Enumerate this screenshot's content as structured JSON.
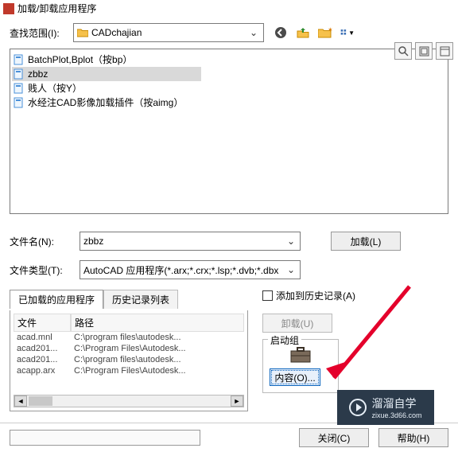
{
  "window": {
    "title": "加载/卸载应用程序"
  },
  "lookin": {
    "label": "查找范围(I):",
    "value": "CADchajian"
  },
  "files": [
    {
      "name": "BatchPlot,Bplot（按bp）",
      "selected": false
    },
    {
      "name": "zbbz",
      "selected": true
    },
    {
      "name": "贱人（按Y）",
      "selected": false
    },
    {
      "name": "水经注CAD影像加载插件（按aimg）",
      "selected": false
    }
  ],
  "filename": {
    "label": "文件名(N):",
    "value": "zbbz"
  },
  "filetype": {
    "label": "文件类型(T):",
    "value": "AutoCAD 应用程序(*.arx;*.crx;*.lsp;*.dvb;*.dbx"
  },
  "buttons": {
    "load": "加载(L)",
    "unload": "卸载(U)",
    "contents": "内容(O)...",
    "close": "关闭(C)",
    "help": "帮助(H)"
  },
  "tabs": {
    "loaded": "已加载的应用程序",
    "history": "历史记录列表"
  },
  "grid": {
    "col_file": "文件",
    "col_path": "路径",
    "rows": [
      {
        "file": "acad.mnl",
        "path": "C:\\program files\\autodesk..."
      },
      {
        "file": "acad201...",
        "path": "C:\\Program Files\\Autodesk..."
      },
      {
        "file": "acad201...",
        "path": "C:\\program files\\autodesk..."
      },
      {
        "file": "acapp.arx",
        "path": "C:\\Program Files\\Autodesk..."
      }
    ]
  },
  "right": {
    "add_history": "添加到历史记录(A)",
    "startup_group": "启动组"
  },
  "watermark": {
    "brand": "溜溜自学",
    "url": "zixue.3d66.com"
  }
}
